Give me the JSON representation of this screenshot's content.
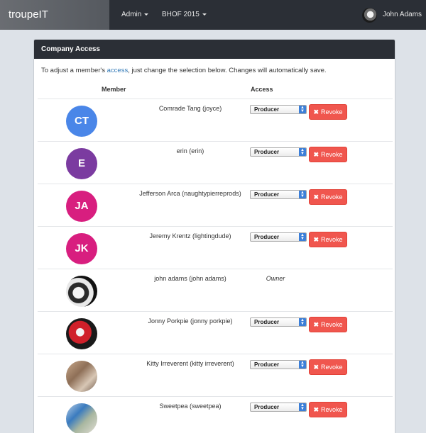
{
  "navbar": {
    "brand": "troupeIT",
    "menus": [
      {
        "label": "Admin"
      },
      {
        "label": "BHOF 2015"
      },
      {
        "label": "John Adams"
      }
    ]
  },
  "panel": {
    "title": "Company Access",
    "intro_before": "To adjust a member's ",
    "intro_link": "access",
    "intro_after": ", just change the selection below. Changes will automatically save.",
    "col_member": "Member",
    "col_access": "Access"
  },
  "members": [
    {
      "name": "Comrade Tang (joyce)",
      "initials": "CT",
      "avatar_color": "#4a86e8",
      "access": "Producer",
      "can_revoke": true
    },
    {
      "name": "erin (erin)",
      "initials": "E",
      "avatar_color": "#7b3ba0",
      "access": "Producer",
      "can_revoke": true
    },
    {
      "name": "Jefferson Arca (naughtypierreprods)",
      "initials": "JA",
      "avatar_color": "#d81e7f",
      "access": "Producer",
      "can_revoke": true
    },
    {
      "name": "Jeremy Krentz (lightingdude)",
      "initials": "JK",
      "avatar_color": "#d81e7f",
      "access": "Producer",
      "can_revoke": true
    },
    {
      "name": "john adams (john adams)",
      "initials": "",
      "avatar_color": "",
      "access": "Owner",
      "can_revoke": false
    },
    {
      "name": "Jonny Porkpie (jonny porkpie)",
      "initials": "",
      "avatar_color": "",
      "access": "Producer",
      "can_revoke": true
    },
    {
      "name": "Kitty Irreverent (kitty irreverent)",
      "initials": "",
      "avatar_color": "",
      "access": "Producer",
      "can_revoke": true
    },
    {
      "name": "Sweetpea (sweetpea)",
      "initials": "",
      "avatar_color": "",
      "access": "Producer",
      "can_revoke": true
    }
  ],
  "revoke_label": "Revoke",
  "colors": {
    "navbar": "#2b2f36",
    "revoke": "#f0564e",
    "link": "#337ab7",
    "select_arrow": "#3c7fd8"
  }
}
